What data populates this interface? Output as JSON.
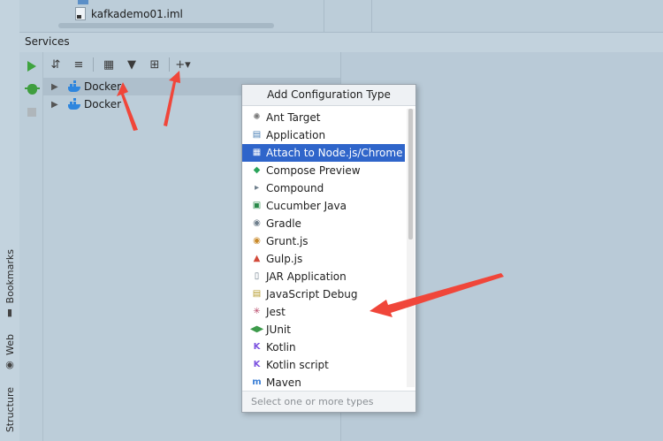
{
  "project": {
    "file_name": "kafkademo01.iml"
  },
  "services_panel": {
    "title": "Services"
  },
  "side_tabs": {
    "bookmarks": "Bookmarks",
    "web": "Web",
    "structure": "Structure"
  },
  "tree": {
    "items": [
      {
        "label": "Docker"
      },
      {
        "label": "Docker"
      }
    ]
  },
  "popup": {
    "title": "Add Configuration Type",
    "footer": "Select one or more types",
    "selected_index": 2,
    "items": [
      {
        "label": "Ant Target",
        "icon": "ant-icon"
      },
      {
        "label": "Application",
        "icon": "application-icon"
      },
      {
        "label": "Attach to Node.js/Chrome",
        "icon": "nodejs-attach-icon"
      },
      {
        "label": "Compose Preview",
        "icon": "compose-preview-icon"
      },
      {
        "label": "Compound",
        "icon": "compound-icon"
      },
      {
        "label": "Cucumber Java",
        "icon": "cucumber-icon"
      },
      {
        "label": "Gradle",
        "icon": "gradle-icon"
      },
      {
        "label": "Grunt.js",
        "icon": "grunt-icon"
      },
      {
        "label": "Gulp.js",
        "icon": "gulp-icon"
      },
      {
        "label": "JAR Application",
        "icon": "jar-icon"
      },
      {
        "label": "JavaScript Debug",
        "icon": "js-debug-icon"
      },
      {
        "label": "Jest",
        "icon": "jest-icon"
      },
      {
        "label": "JUnit",
        "icon": "junit-icon"
      },
      {
        "label": "Kotlin",
        "icon": "kotlin-icon"
      },
      {
        "label": "Kotlin script",
        "icon": "kotlin-script-icon"
      },
      {
        "label": "Maven",
        "icon": "maven-icon"
      }
    ]
  },
  "colors": {
    "selection": "#2f65ca",
    "annotation_arrow": "#f0463a",
    "run_green": "#3fa43f",
    "docker_blue": "#2e86de"
  }
}
